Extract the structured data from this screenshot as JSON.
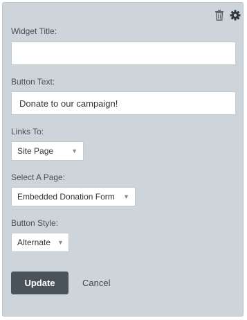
{
  "widget_title": {
    "label": "Widget Title:",
    "value": "",
    "placeholder": ""
  },
  "button_text": {
    "label": "Button Text:",
    "value": "Donate to our campaign!"
  },
  "links_to": {
    "label": "Links To:",
    "selected": "Site Page"
  },
  "select_page": {
    "label": "Select A Page:",
    "selected": "Embedded Donation Form"
  },
  "button_style": {
    "label": "Button Style:",
    "selected": "Alternate"
  },
  "actions": {
    "update_label": "Update",
    "cancel_label": "Cancel"
  },
  "icons": {
    "delete": "trash-icon",
    "settings": "gear-icon"
  },
  "colors": {
    "panel_bg": "#cdd5da",
    "update_button_bg": "#4a5359"
  }
}
